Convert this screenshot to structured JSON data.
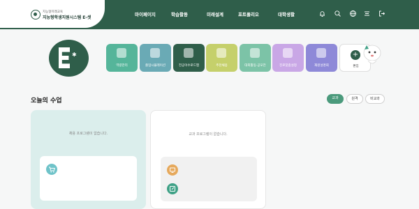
{
  "header": {
    "logo_subtitle": "지능형미래교육",
    "logo_title": "지능형학생지원시스템 E-셋",
    "nav": [
      "마이페이지",
      "학습활동",
      "미래설계",
      "포트폴리오",
      "대학생활"
    ]
  },
  "icons": [
    "bell-icon",
    "search-icon",
    "globe-icon",
    "menu-icon",
    "logout-icon"
  ],
  "profile": {
    "avatar_letter": "E"
  },
  "tiles": [
    {
      "label": "역량관리",
      "color": "#55b59a"
    },
    {
      "label": "졸업시뮬레이션",
      "color": "#6aaab5"
    },
    {
      "label": "전공이수로드맵",
      "color": "#2f5e4a"
    },
    {
      "label": "추천채용",
      "color": "#c5d06b"
    },
    {
      "label": "대외활동·공모전",
      "color": "#7cc3a7"
    },
    {
      "label": "진로맞춤설정",
      "color": "#c9a7e6"
    },
    {
      "label": "재원설명회",
      "color": "#8e89d8"
    },
    {
      "label": "편집",
      "color": "#ffffff"
    }
  ],
  "section": {
    "title": "오늘의 수업",
    "filters": [
      "교과",
      "원격",
      "비교과"
    ]
  },
  "cards": {
    "left_empty": "채용 프로그램이 없습니다.",
    "right_empty": "교과 프로그램이 없습니다."
  }
}
